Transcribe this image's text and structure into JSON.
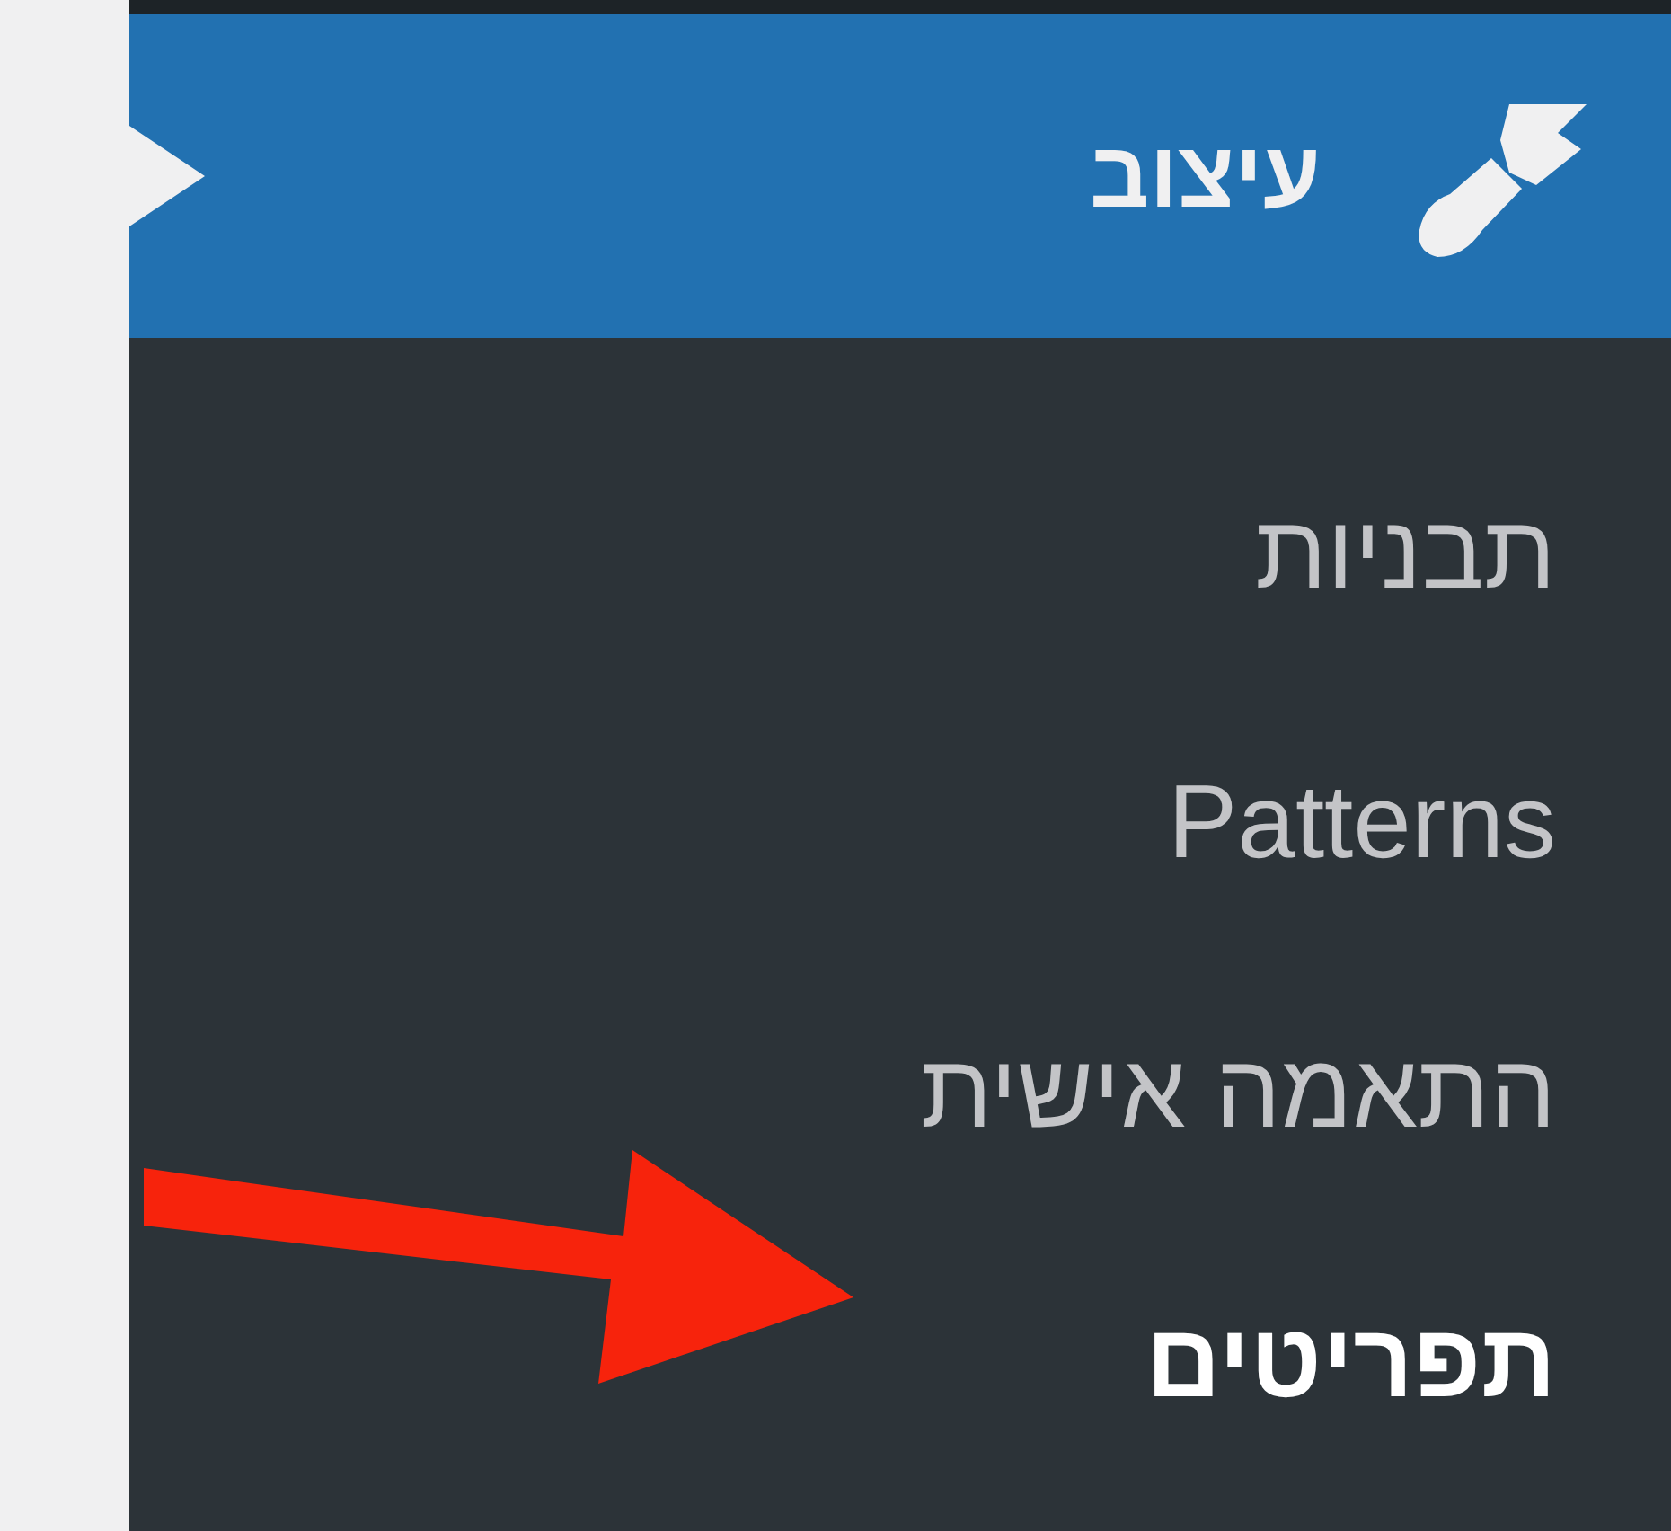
{
  "menu": {
    "title": "עיצוב",
    "selected": true,
    "items": [
      {
        "label": "תבניות",
        "selected": false
      },
      {
        "label": "Patterns",
        "selected": false
      },
      {
        "label": "התאמה אישית",
        "selected": false
      },
      {
        "label": "תפריטים",
        "selected": true
      }
    ]
  }
}
